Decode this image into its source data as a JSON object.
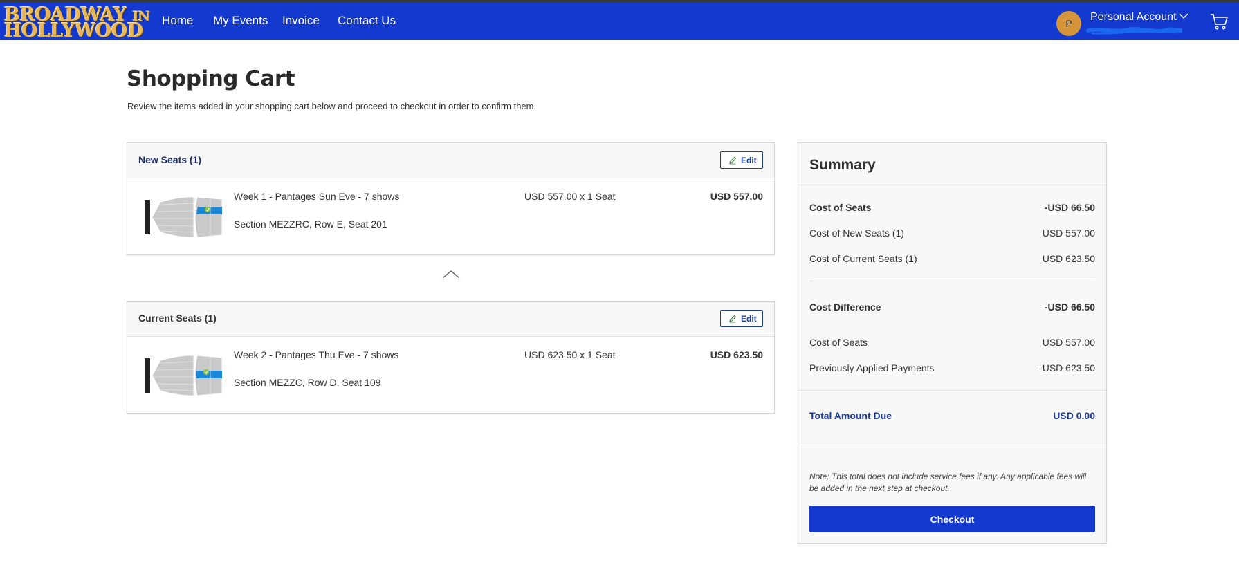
{
  "header": {
    "logo": {
      "line1": "BROADWAY",
      "line1_suffix": "IN",
      "line2": "HOLLYWOOD"
    },
    "nav": [
      {
        "label": "Home"
      },
      {
        "label": "My Events"
      },
      {
        "label": "Invoice"
      },
      {
        "label": "Contact Us"
      }
    ],
    "account": {
      "avatar_initial": "P",
      "label": "Personal Account",
      "dropdown_icon": "chevron-down-icon"
    },
    "cart_icon": "cart-icon",
    "colors": {
      "nav_bg": "#1339cf",
      "logo_gold": "#e7b75a",
      "avatar_bg": "#d5953b"
    }
  },
  "page": {
    "title": "Shopping Cart",
    "subtitle": "Review the items added in your shopping cart below and proceed to checkout in order to confirm them."
  },
  "new_seats": {
    "title": "New Seats (1)",
    "edit_label": "Edit",
    "items": [
      {
        "event": "Week 1 - Pantages Sun Eve - 7 shows",
        "location": "Section MEZZRC, Row E, Seat 201",
        "unit_price": "USD 557.00 x 1 Seat",
        "total": "USD 557.00",
        "map_stage_label": "STAGE"
      }
    ]
  },
  "current_seats": {
    "title": "Current Seats (1)",
    "edit_label": "Edit",
    "items": [
      {
        "event": "Week 2 - Pantages Thu Eve - 7 shows",
        "location": "Section MEZZC, Row D, Seat 109",
        "unit_price": "USD 623.50 x 1 Seat",
        "total": "USD 623.50",
        "map_stage_label": "STAGE"
      }
    ]
  },
  "collapse_icon": "chevron-up-icon",
  "summary": {
    "title": "Summary",
    "cost_of_seats": {
      "label": "Cost of Seats",
      "value": "-USD 66.50"
    },
    "cost_new_seats": {
      "label": "Cost of New Seats (1)",
      "value": "USD 557.00"
    },
    "cost_current_seats": {
      "label": "Cost of Current Seats (1)",
      "value": "USD 623.50"
    },
    "cost_difference": {
      "label": "Cost Difference",
      "value": "-USD 66.50"
    },
    "cost_of_seats_2": {
      "label": "Cost of Seats",
      "value": "USD 557.00"
    },
    "previous_payments": {
      "label": "Previously Applied Payments",
      "value": "-USD 623.50"
    },
    "total_due": {
      "label": "Total Amount Due",
      "value": "USD 0.00"
    },
    "note": "Note: This total does not include service fees if any. Any applicable fees will be added in the next step at checkout.",
    "checkout_label": "Checkout",
    "colors": {
      "total_text": "#1b3b9a",
      "checkout_bg": "#1339cf"
    }
  }
}
